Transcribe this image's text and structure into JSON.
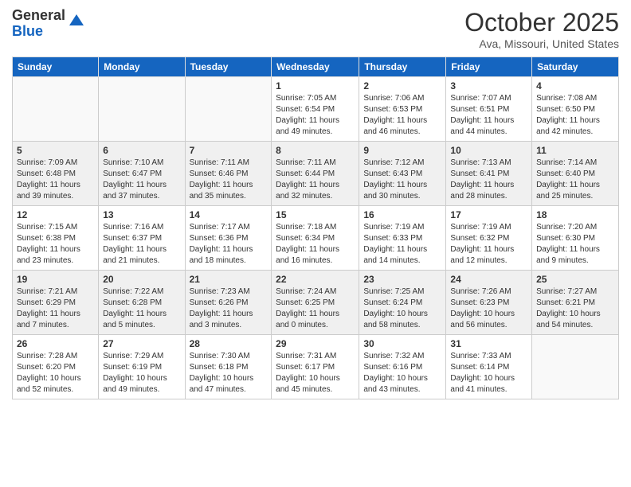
{
  "header": {
    "logo_general": "General",
    "logo_blue": "Blue",
    "title": "October 2025",
    "location": "Ava, Missouri, United States"
  },
  "days_of_week": [
    "Sunday",
    "Monday",
    "Tuesday",
    "Wednesday",
    "Thursday",
    "Friday",
    "Saturday"
  ],
  "weeks": [
    [
      {
        "day": "",
        "info": ""
      },
      {
        "day": "",
        "info": ""
      },
      {
        "day": "",
        "info": ""
      },
      {
        "day": "1",
        "info": "Sunrise: 7:05 AM\nSunset: 6:54 PM\nDaylight: 11 hours\nand 49 minutes."
      },
      {
        "day": "2",
        "info": "Sunrise: 7:06 AM\nSunset: 6:53 PM\nDaylight: 11 hours\nand 46 minutes."
      },
      {
        "day": "3",
        "info": "Sunrise: 7:07 AM\nSunset: 6:51 PM\nDaylight: 11 hours\nand 44 minutes."
      },
      {
        "day": "4",
        "info": "Sunrise: 7:08 AM\nSunset: 6:50 PM\nDaylight: 11 hours\nand 42 minutes."
      }
    ],
    [
      {
        "day": "5",
        "info": "Sunrise: 7:09 AM\nSunset: 6:48 PM\nDaylight: 11 hours\nand 39 minutes."
      },
      {
        "day": "6",
        "info": "Sunrise: 7:10 AM\nSunset: 6:47 PM\nDaylight: 11 hours\nand 37 minutes."
      },
      {
        "day": "7",
        "info": "Sunrise: 7:11 AM\nSunset: 6:46 PM\nDaylight: 11 hours\nand 35 minutes."
      },
      {
        "day": "8",
        "info": "Sunrise: 7:11 AM\nSunset: 6:44 PM\nDaylight: 11 hours\nand 32 minutes."
      },
      {
        "day": "9",
        "info": "Sunrise: 7:12 AM\nSunset: 6:43 PM\nDaylight: 11 hours\nand 30 minutes."
      },
      {
        "day": "10",
        "info": "Sunrise: 7:13 AM\nSunset: 6:41 PM\nDaylight: 11 hours\nand 28 minutes."
      },
      {
        "day": "11",
        "info": "Sunrise: 7:14 AM\nSunset: 6:40 PM\nDaylight: 11 hours\nand 25 minutes."
      }
    ],
    [
      {
        "day": "12",
        "info": "Sunrise: 7:15 AM\nSunset: 6:38 PM\nDaylight: 11 hours\nand 23 minutes."
      },
      {
        "day": "13",
        "info": "Sunrise: 7:16 AM\nSunset: 6:37 PM\nDaylight: 11 hours\nand 21 minutes."
      },
      {
        "day": "14",
        "info": "Sunrise: 7:17 AM\nSunset: 6:36 PM\nDaylight: 11 hours\nand 18 minutes."
      },
      {
        "day": "15",
        "info": "Sunrise: 7:18 AM\nSunset: 6:34 PM\nDaylight: 11 hours\nand 16 minutes."
      },
      {
        "day": "16",
        "info": "Sunrise: 7:19 AM\nSunset: 6:33 PM\nDaylight: 11 hours\nand 14 minutes."
      },
      {
        "day": "17",
        "info": "Sunrise: 7:19 AM\nSunset: 6:32 PM\nDaylight: 11 hours\nand 12 minutes."
      },
      {
        "day": "18",
        "info": "Sunrise: 7:20 AM\nSunset: 6:30 PM\nDaylight: 11 hours\nand 9 minutes."
      }
    ],
    [
      {
        "day": "19",
        "info": "Sunrise: 7:21 AM\nSunset: 6:29 PM\nDaylight: 11 hours\nand 7 minutes."
      },
      {
        "day": "20",
        "info": "Sunrise: 7:22 AM\nSunset: 6:28 PM\nDaylight: 11 hours\nand 5 minutes."
      },
      {
        "day": "21",
        "info": "Sunrise: 7:23 AM\nSunset: 6:26 PM\nDaylight: 11 hours\nand 3 minutes."
      },
      {
        "day": "22",
        "info": "Sunrise: 7:24 AM\nSunset: 6:25 PM\nDaylight: 11 hours\nand 0 minutes."
      },
      {
        "day": "23",
        "info": "Sunrise: 7:25 AM\nSunset: 6:24 PM\nDaylight: 10 hours\nand 58 minutes."
      },
      {
        "day": "24",
        "info": "Sunrise: 7:26 AM\nSunset: 6:23 PM\nDaylight: 10 hours\nand 56 minutes."
      },
      {
        "day": "25",
        "info": "Sunrise: 7:27 AM\nSunset: 6:21 PM\nDaylight: 10 hours\nand 54 minutes."
      }
    ],
    [
      {
        "day": "26",
        "info": "Sunrise: 7:28 AM\nSunset: 6:20 PM\nDaylight: 10 hours\nand 52 minutes."
      },
      {
        "day": "27",
        "info": "Sunrise: 7:29 AM\nSunset: 6:19 PM\nDaylight: 10 hours\nand 49 minutes."
      },
      {
        "day": "28",
        "info": "Sunrise: 7:30 AM\nSunset: 6:18 PM\nDaylight: 10 hours\nand 47 minutes."
      },
      {
        "day": "29",
        "info": "Sunrise: 7:31 AM\nSunset: 6:17 PM\nDaylight: 10 hours\nand 45 minutes."
      },
      {
        "day": "30",
        "info": "Sunrise: 7:32 AM\nSunset: 6:16 PM\nDaylight: 10 hours\nand 43 minutes."
      },
      {
        "day": "31",
        "info": "Sunrise: 7:33 AM\nSunset: 6:14 PM\nDaylight: 10 hours\nand 41 minutes."
      },
      {
        "day": "",
        "info": ""
      }
    ]
  ]
}
